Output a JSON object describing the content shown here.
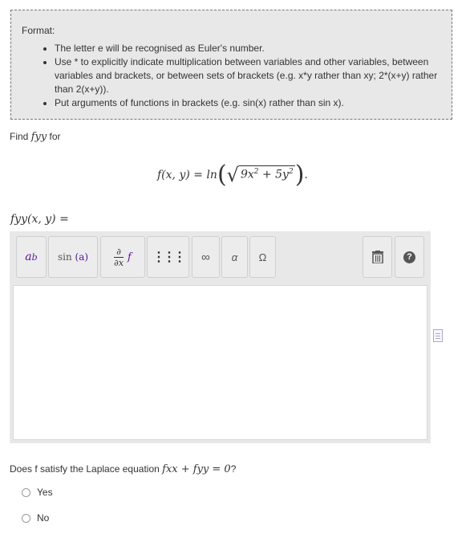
{
  "format": {
    "title": "Format:",
    "bullets": [
      "The letter e will be recognised as Euler's number.",
      "Use * to explicitly indicate multiplication between variables and other variables, between variables and brackets, or between sets of brackets (e.g. x*y rather than xy; 2*(x+y) rather than 2(x+y)).",
      "Put arguments of functions in brackets (e.g. sin(x) rather than sin x)."
    ]
  },
  "prompt": {
    "find": "Find",
    "fyy": "fyy",
    "for": "for"
  },
  "equation": {
    "lhs": "f(x, y) = ln",
    "radicand_a": "9x",
    "exp_a": "2",
    "plus": " + 5y",
    "exp_b": "2",
    "end": "."
  },
  "answer_label": "fyy(x, y) =",
  "toolbar": {
    "power": {
      "base": "a",
      "exp": "b"
    },
    "function": {
      "name": "sin",
      "arg": "(a)"
    },
    "derivative": {
      "num": "∂",
      "den": "∂x",
      "f": "f"
    },
    "matrix": "⋮⋮⋮",
    "infinity": "∞",
    "greek": "α",
    "symbols": "Ω",
    "trash": "🗑",
    "help": "?"
  },
  "question": {
    "text": "Does f satisfy the Laplace equation",
    "eq": "fxx + fyy = 0",
    "end": "?"
  },
  "options": [
    "Yes",
    "No"
  ]
}
